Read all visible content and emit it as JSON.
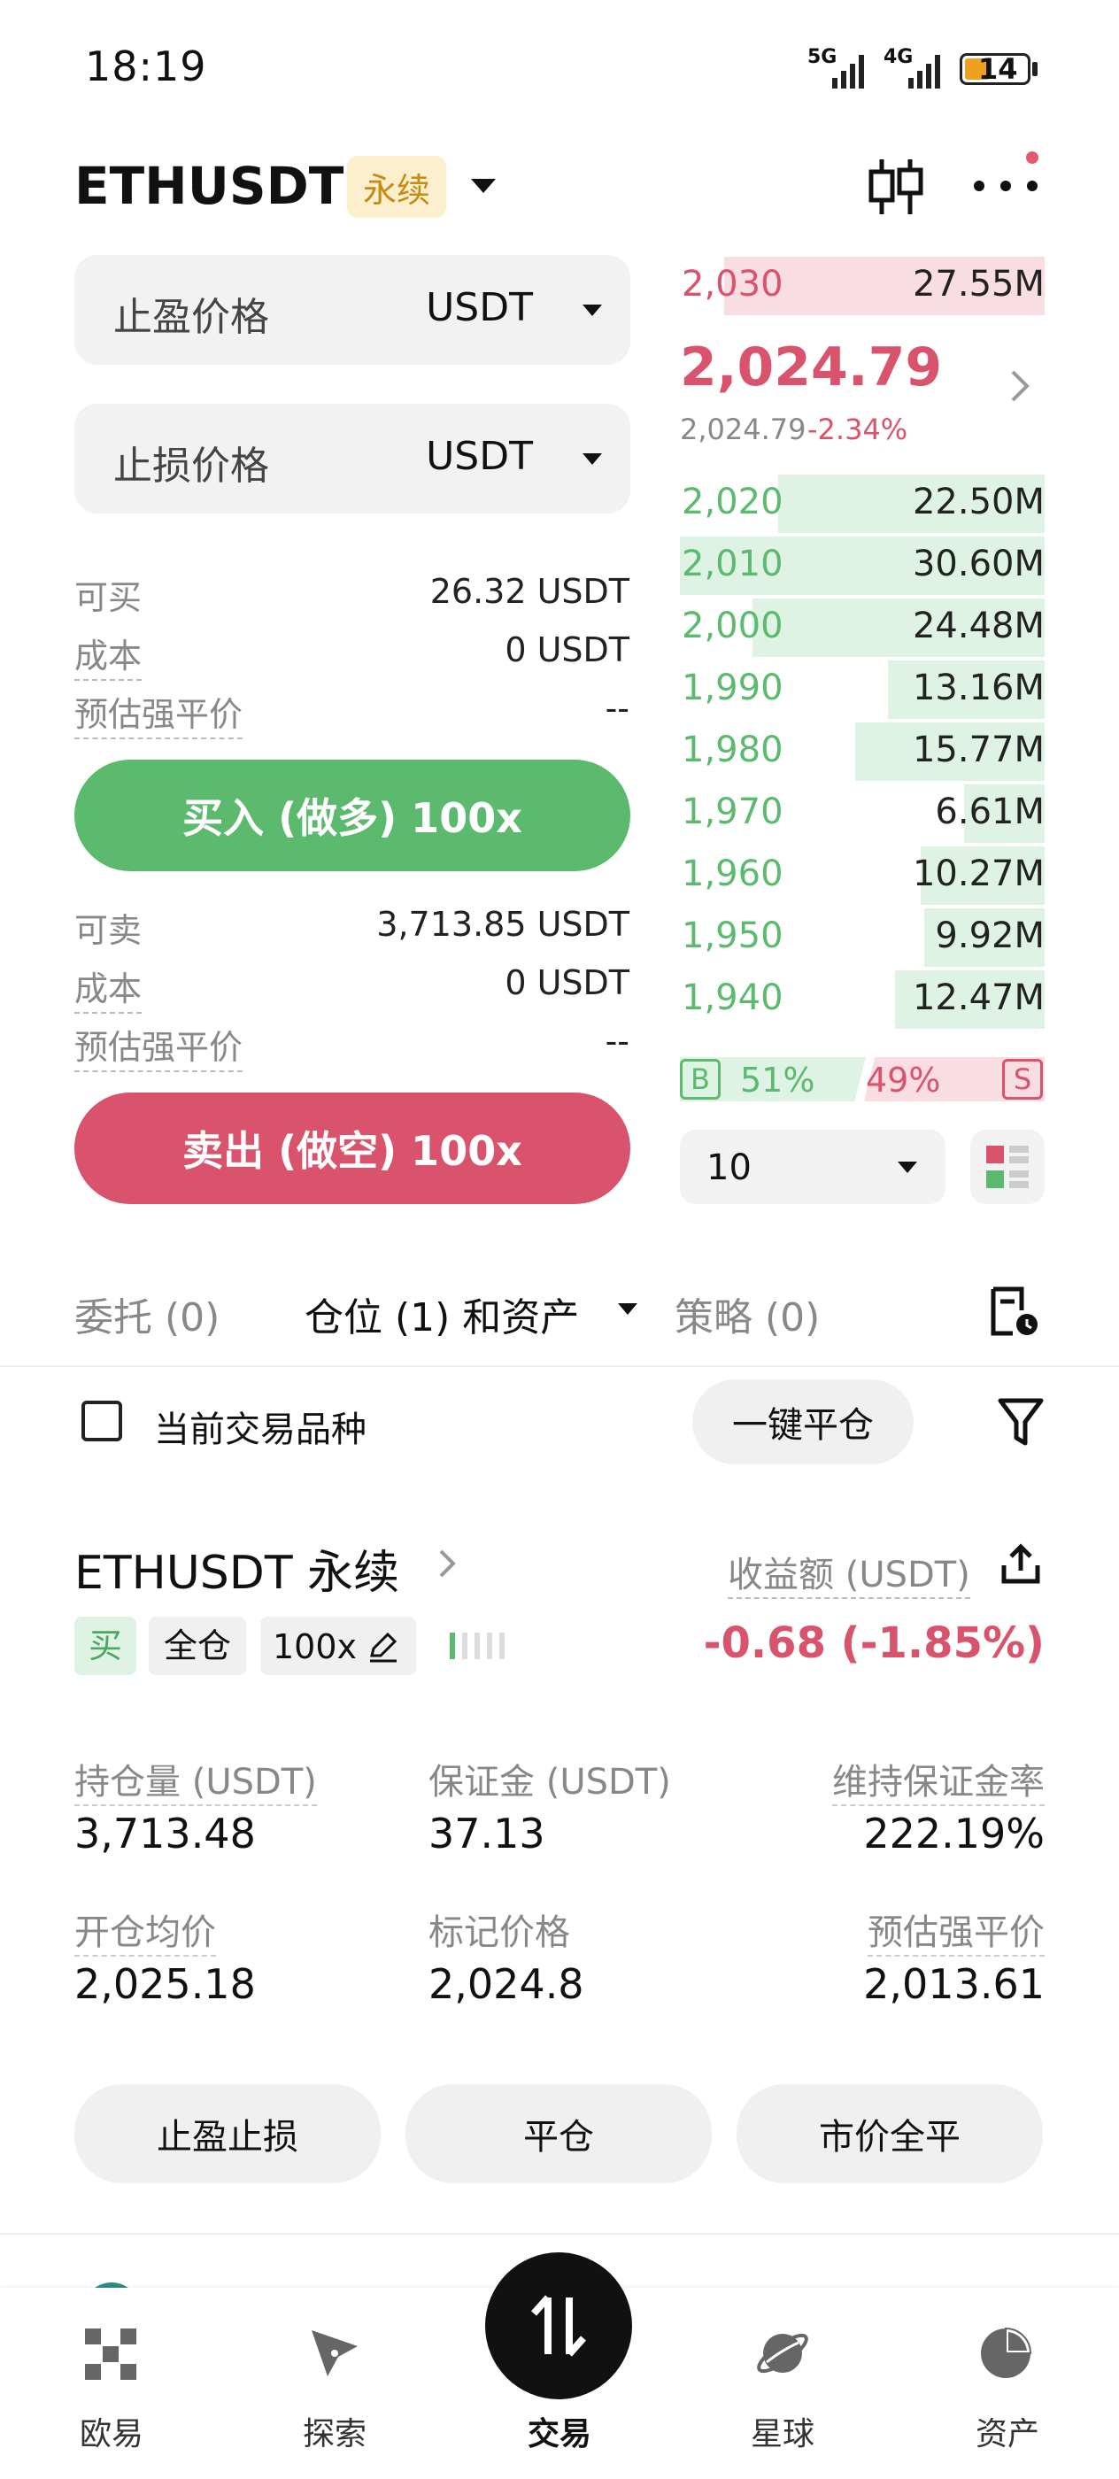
{
  "status_bar": {
    "time": "18:19",
    "net1": "5G",
    "net2": "4G",
    "battery": "14"
  },
  "header": {
    "pair": "ETHUSDT",
    "badge": "永续"
  },
  "order_form": {
    "tp_label": "止盈价格",
    "tp_unit": "USDT",
    "sl_label": "止损价格",
    "sl_unit": "USDT",
    "buy_info": [
      {
        "label": "可买",
        "value": "26.32 USDT"
      },
      {
        "label": "成本",
        "value": "0 USDT"
      },
      {
        "label": "预估强平价",
        "value": "--"
      }
    ],
    "buy_button": "买入 (做多) 100x",
    "sell_info": [
      {
        "label": "可卖",
        "value": "3,713.85 USDT"
      },
      {
        "label": "成本",
        "value": "0 USDT"
      },
      {
        "label": "预估强平价",
        "value": "--"
      }
    ],
    "sell_button": "卖出 (做空) 100x"
  },
  "orderbook": {
    "ask": {
      "price": "2,030",
      "volume": "27.55M",
      "depth": 0.88
    },
    "last_price": "2,024.79",
    "mark_price": "2,024.79",
    "change": "-2.34%",
    "bids": [
      {
        "price": "2,020",
        "volume": "22.50M",
        "depth": 0.73
      },
      {
        "price": "2,010",
        "volume": "30.60M",
        "depth": 1.0
      },
      {
        "price": "2,000",
        "volume": "24.48M",
        "depth": 0.8
      },
      {
        "price": "1,990",
        "volume": "13.16M",
        "depth": 0.43
      },
      {
        "price": "1,980",
        "volume": "15.77M",
        "depth": 0.52
      },
      {
        "price": "1,970",
        "volume": "6.61M",
        "depth": 0.22
      },
      {
        "price": "1,960",
        "volume": "10.27M",
        "depth": 0.34
      },
      {
        "price": "1,950",
        "volume": "9.92M",
        "depth": 0.33
      },
      {
        "price": "1,940",
        "volume": "12.47M",
        "depth": 0.41
      }
    ],
    "buy_ratio_label": "B",
    "buy_ratio": "51%",
    "sell_ratio_label": "S",
    "sell_ratio": "49%",
    "buy_ratio_value": 0.51,
    "depth_select": "10"
  },
  "tabs": {
    "orders": "委托 (0)",
    "positions": "仓位 (1) 和资产",
    "strategy": "策略 (0)"
  },
  "filter": {
    "current_only": "当前交易品种",
    "close_all": "一键平仓"
  },
  "position": {
    "title": "ETHUSDT 永续",
    "pnl_label": "收益额 (USDT)",
    "pnl_value": "-0.68 (-1.85%)",
    "tag_side": "买",
    "tag_margin": "全仓",
    "tag_leverage": "100x",
    "stats": [
      {
        "label": "持仓量 (USDT)",
        "value": "3,713.48"
      },
      {
        "label": "保证金 (USDT)",
        "value": "37.13"
      },
      {
        "label": "维持保证金率",
        "value": "222.19%"
      },
      {
        "label": "开仓均价",
        "value": "2,025.18"
      },
      {
        "label": "标记价格",
        "value": "2,024.8"
      },
      {
        "label": "预估强平价",
        "value": "2,013.61"
      }
    ],
    "actions": [
      "止盈止损",
      "平仓",
      "市价全平"
    ]
  },
  "bottom_nav": [
    {
      "label": "欧易"
    },
    {
      "label": "探索"
    },
    {
      "label": "交易"
    },
    {
      "label": "星球"
    },
    {
      "label": "资产"
    }
  ],
  "colors": {
    "green": "#5cba6e",
    "red": "#d9536c",
    "bid_bg": "#dff3e4",
    "ask_bg": "#f8dde3"
  }
}
